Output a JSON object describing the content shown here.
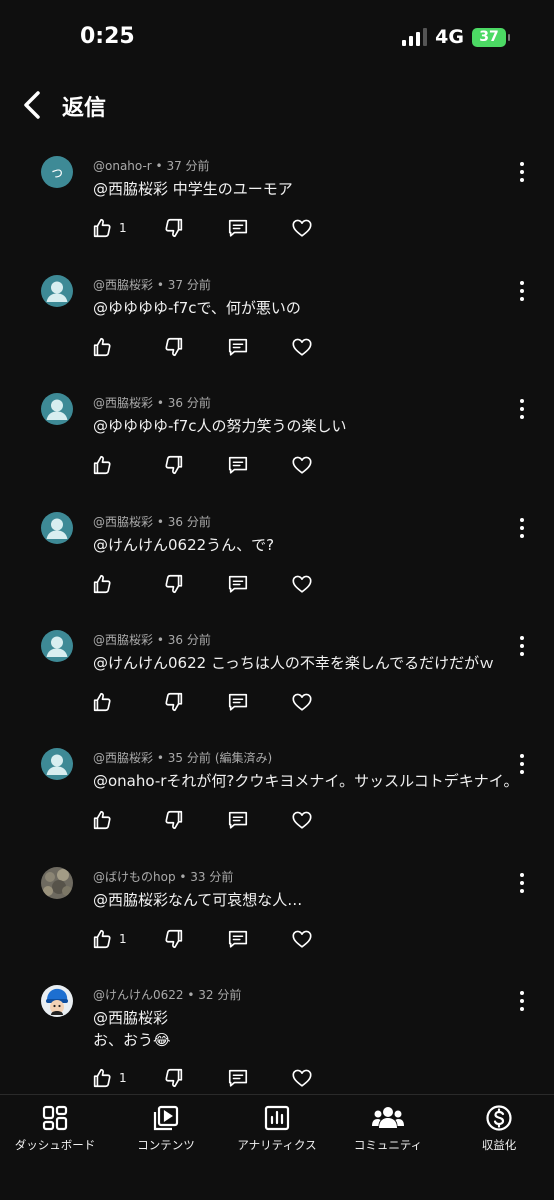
{
  "status_bar": {
    "time": "0:25",
    "network": "4G",
    "battery": "37"
  },
  "header": {
    "title": "返信"
  },
  "comments": [
    {
      "author": "@onaho-r",
      "time": "37 分前",
      "edited": "",
      "lines": [
        "@西脇桜彩 中学生のユーモア"
      ],
      "likes": "1",
      "avatar": "letter",
      "avatar_letter": "っ"
    },
    {
      "author": "@西脇桜彩",
      "time": "37 分前",
      "edited": "",
      "lines": [
        "@ゆゆゆゆ-f7cで、何が悪いの"
      ],
      "likes": "",
      "avatar": "default"
    },
    {
      "author": "@西脇桜彩",
      "time": "36 分前",
      "edited": "",
      "lines": [
        "@ゆゆゆゆ-f7c人の努力笑うの楽しい"
      ],
      "likes": "",
      "avatar": "default"
    },
    {
      "author": "@西脇桜彩",
      "time": "36 分前",
      "edited": "",
      "lines": [
        "@けんけん0622うん、で?"
      ],
      "likes": "",
      "avatar": "default"
    },
    {
      "author": "@西脇桜彩",
      "time": "36 分前",
      "edited": "",
      "lines": [
        "@けんけん0622 こっちは人の不幸を楽しんでるだけだがｗ"
      ],
      "likes": "",
      "avatar": "default"
    },
    {
      "author": "@西脇桜彩",
      "time": "35 分前",
      "edited": "(編集済み)",
      "lines": [
        "@onaho-rそれが何?クウキヨメナイ。サッスルコトデキナイ。"
      ],
      "likes": "",
      "avatar": "default"
    },
    {
      "author": "@ばけものhop",
      "time": "33 分前",
      "edited": "",
      "lines": [
        "@西脇桜彩なんて可哀想な人…"
      ],
      "likes": "1",
      "avatar": "photo"
    },
    {
      "author": "@けんけん0622",
      "time": "32 分前",
      "edited": "",
      "lines": [
        "@西脇桜彩",
        "お、おう😂"
      ],
      "likes": "1",
      "avatar": "character"
    }
  ],
  "bottom_nav": [
    {
      "label": "ダッシュボード",
      "icon": "dashboard-icon"
    },
    {
      "label": "コンテンツ",
      "icon": "content-icon"
    },
    {
      "label": "アナリティクス",
      "icon": "analytics-icon"
    },
    {
      "label": "コミュニティ",
      "icon": "community-icon"
    },
    {
      "label": "収益化",
      "icon": "monetization-icon"
    }
  ],
  "colors": {
    "background": "#0f0f0f",
    "text": "#f1f1f1",
    "meta": "#aaaaaa",
    "avatar": "#3e8a96",
    "battery": "#4cd964"
  }
}
